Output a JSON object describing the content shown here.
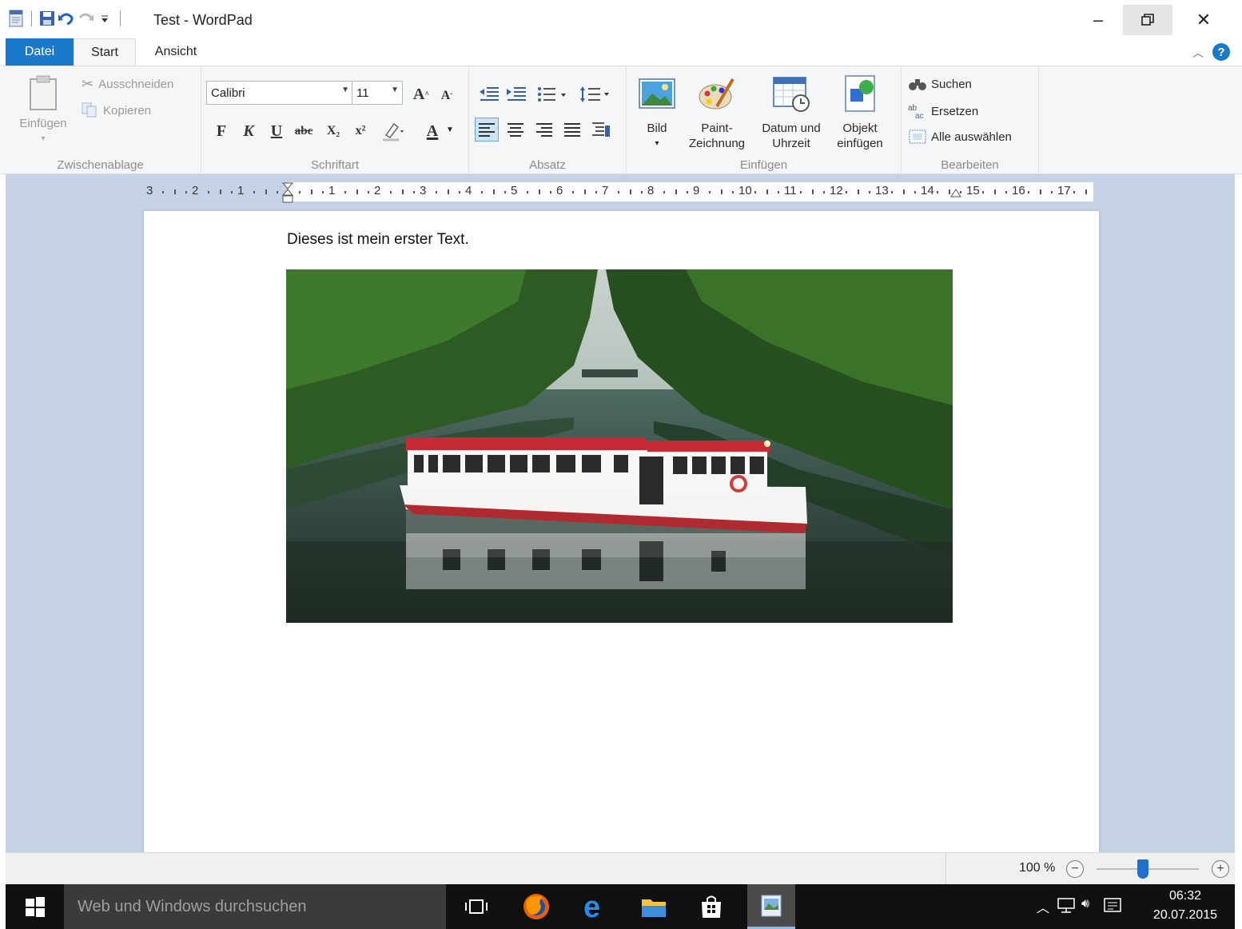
{
  "window": {
    "title": "Test - WordPad",
    "minimize": "–",
    "restore": "❐",
    "close": "✕"
  },
  "tabs": [
    {
      "label": "Datei"
    },
    {
      "label": "Start"
    },
    {
      "label": "Ansicht"
    }
  ],
  "ribbon": {
    "clipboard": {
      "label": "Zwischenablage",
      "paste": "Einfügen",
      "cut": "Ausschneiden",
      "copy": "Kopieren"
    },
    "font": {
      "label": "Schriftart",
      "family": "Calibri",
      "size": "11",
      "bold": "F",
      "italic": "K",
      "underline": "U",
      "strike": "abc",
      "subscript": "X₂",
      "superscript": "x²",
      "color": "A"
    },
    "paragraph": {
      "label": "Absatz"
    },
    "insert": {
      "label": "Einfügen",
      "picture": "Bild",
      "paint_line1": "Paint-",
      "paint_line2": "Zeichnung",
      "datetime_line1": "Datum und",
      "datetime_line2": "Uhrzeit",
      "object_line1": "Objekt",
      "object_line2": "einfügen"
    },
    "edit": {
      "label": "Bearbeiten",
      "find": "Suchen",
      "replace": "Ersetzen",
      "select_all": "Alle auswählen"
    }
  },
  "ruler": {
    "marks": [
      "3",
      "2",
      "1",
      "1",
      "2",
      "3",
      "4",
      "5",
      "6",
      "7",
      "8",
      "9",
      "10",
      "11",
      "12",
      "13",
      "14",
      "15",
      "16",
      "17"
    ]
  },
  "document": {
    "text": "Dieses ist mein erster Text."
  },
  "statusbar": {
    "zoom": "100 %",
    "zoom_out": "−",
    "zoom_in": "+",
    "zoom_fraction": 0.45
  },
  "taskbar": {
    "search_placeholder": "Web und Windows durchsuchen",
    "time": "06:32",
    "date": "20.07.2015"
  }
}
